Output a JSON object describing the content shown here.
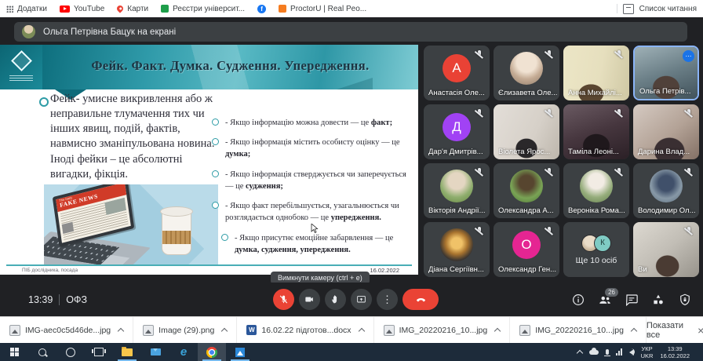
{
  "browser": {
    "bookmarks": [
      {
        "label": "Додатки"
      },
      {
        "label": "YouTube"
      },
      {
        "label": "Карти"
      },
      {
        "label": "Реєстри університ..."
      },
      {
        "label": ""
      },
      {
        "label": "ProctorU | Real Peo..."
      }
    ],
    "reading_list": "Список читання"
  },
  "banner": {
    "text": "Ольга Петрівна Бацук на екрані"
  },
  "slide": {
    "title": "Фейк. Факт.  Думка. Судження. Упередження.",
    "definition": "Фейк- умисне викривлення або ж неправильне тлумачення тих чи інших явищ, подій, фактів, навмисно зманіпульована новина. Іноді фейки – це абсолютні вигадки, фікція.",
    "bullets": [
      {
        "text": "- Якщо інформацію можна довести — це ",
        "bold": "факт;"
      },
      {
        "text": "- Якщо інформація містить особисту оцінку — це ",
        "bold": "думка;"
      },
      {
        "text": "- Якщо інформація стверджується чи заперечується — це ",
        "bold": "судження;"
      },
      {
        "text": "- Якщо факт перебільшується, узагальнюється чи розглядається однобоко — це ",
        "bold": "упередження."
      },
      {
        "text": "- Якщо присутнє емоційне забарвлення — це ",
        "bold": "думка, судження, упередження."
      }
    ],
    "newspaper_small": "The Daily",
    "newspaper_masthead": "FAKE NEWS",
    "footer_left": "ПІБ дослідника, посада",
    "footer_right": "16.02.2022"
  },
  "participants": [
    {
      "name": "Анастасія Оле...",
      "initial": "А",
      "avatar_style": "background:#e94235"
    },
    {
      "name": "Єлизавета Оле...",
      "avatar_style": "background:radial-gradient(circle at 50% 32%, #f0e2d2 0 35%, #c4ab94 60%, #8f7c6a 100%)"
    },
    {
      "name": "Анна Михайлі...",
      "media_style": "background:radial-gradient(26px 20px at 42% 88%, #5a4631 0 60%, transparent 62%), linear-gradient(100deg, #ece6c6 0%, #e6dfbe 55%, #cfc8a4 100%)"
    },
    {
      "name": "Ольга Петрів...",
      "media_style": "background:radial-gradient(30px 26px at 50% 78%, #50413a 0 55%, transparent 58%), linear-gradient(160deg, #9eb0b6 0%, #6a7e86 50%, #41525b 100%)"
    },
    {
      "name": "Дар'я Дмитрів...",
      "initial": "Д",
      "avatar_style": "background:#a142f4"
    },
    {
      "name": "Віолета Ярос...",
      "media_style": "background:radial-gradient(24px 22px at 50% 80%, #2a282a 0 55%, transparent 58%), linear-gradient(115deg, #e3ded8 0%, #d6d0c8 60%, #bdb6ac 100%)"
    },
    {
      "name": "Таміла Леоні...",
      "media_style": "background:radial-gradient(30px 26px at 50% 75%, #1f181c 0 55%, transparent 58%), linear-gradient(160deg, #6a5a62 0%, #46363e 50%, #2b2026 100%)"
    },
    {
      "name": "Дарина Влад...",
      "media_style": "background:radial-gradient(34px 30px at 55% 85%, #3a2f32 0 55%, transparent 58%), linear-gradient(140deg, #d5cac2 0%, #b3a296 55%, #837065 100%)"
    },
    {
      "name": "Вікторія Андрії...",
      "avatar_style": "background:radial-gradient(circle at 50% 35%, #e4d6c2 0 30%, #8fae6e 60%, #64853f 100%)"
    },
    {
      "name": "Олександра А...",
      "avatar_style": "background:radial-gradient(circle at 50% 40%, #57452f 0 28%, #79a355 60%, #4c7335 100%)"
    },
    {
      "name": "Вероніка Рома...",
      "avatar_style": "background:radial-gradient(circle at 50% 35%, #f2ece4 0 28%, #96ad7c 60%, #637f4c 100%)"
    },
    {
      "name": "Володимир Ол...",
      "avatar_style": "background:radial-gradient(circle at 50% 42%, #40506a 0 30%, #8798a6 60%, #5c6d7c 100%)"
    },
    {
      "name": "Діана Сергіївн...",
      "avatar_style": "background:radial-gradient(circle at 50% 45%, #f0c268 0 22%, #a9742f 45%, #3c3631 70%, #2e2a26 100%)"
    },
    {
      "name": "Олександр Ген...",
      "initial": "О",
      "avatar_style": "background:#e52592"
    },
    {
      "name": "Ще 10 осіб",
      "more_initial": "К",
      "circle1_style": "background:radial-gradient(circle at 50% 35%, #e9dcc8 0 40%, #a8906f 100%)",
      "circle2_style": "background:#7fcbc4;color:#1e3c38"
    },
    {
      "name": "Ви",
      "media_style": "background:radial-gradient(26px 24px at 52% 80%, #4a3b33 0 55%, transparent 58%), linear-gradient(140deg, #ddd9d1 0%, #c2beb6 50%, #97938b 100%)"
    }
  ],
  "toolbar": {
    "time": "13:39",
    "meeting_code": "ОФЗ",
    "tooltip": "Вимкнути камеру (ctrl + e)",
    "participants_badge": "26"
  },
  "downloads": {
    "files": [
      {
        "name": "IMG-aec0c5d46de...jpg",
        "type": "image"
      },
      {
        "name": "Image (29).png",
        "type": "image"
      },
      {
        "name": "16.02.22 підготов...docx",
        "type": "word"
      },
      {
        "name": "IMG_20220216_10...jpg",
        "type": "image"
      },
      {
        "name": "IMG_20220216_10...jpg",
        "type": "image"
      }
    ],
    "show_all": "Показати все"
  },
  "taskbar": {
    "lang_top": "УКР",
    "lang_bottom": "UKR",
    "time": "13:39",
    "date": "16.02.2022"
  },
  "icons": {
    "menu_dots": "⋯",
    "more_vertical": "⋮",
    "close": "×",
    "word_badge": "W",
    "facebook_f": "f",
    "edge_e": "e"
  },
  "colors": {
    "meet_background": "#202124",
    "tile_background": "#3c4043",
    "danger_red": "#ea4335",
    "active_tile_border": "#8ab4f8",
    "slide_accent_teal": "#2e9ca6",
    "slide_band_teal": "#2f9aa9"
  }
}
